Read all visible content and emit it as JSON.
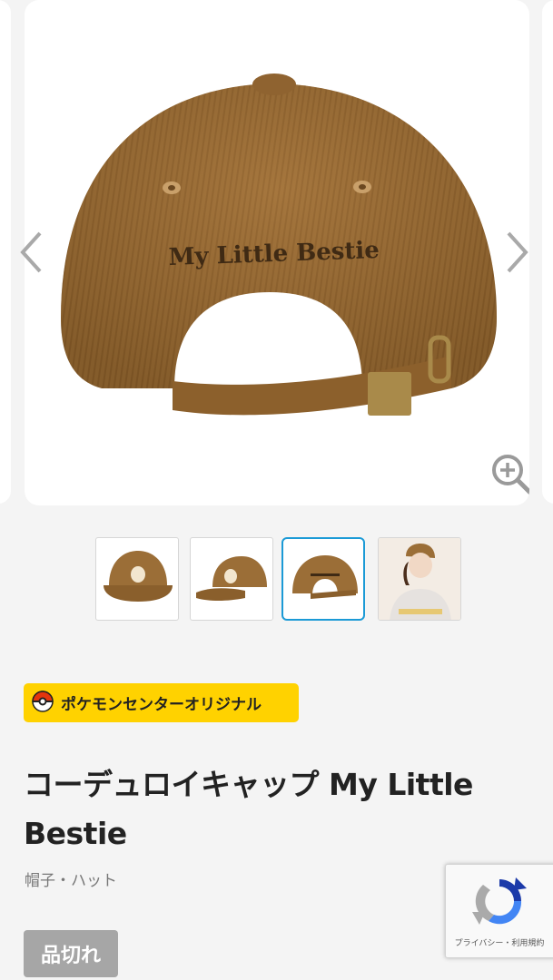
{
  "carousel": {
    "main_image": {
      "embroidery_text": "My Little Bestie",
      "alt": "corduroy cap back view"
    },
    "prev_icon": "chevron-left-icon",
    "next_icon": "chevron-right-icon",
    "zoom_icon": "zoom-in-icon"
  },
  "thumbnails": [
    {
      "view": "front",
      "active": false
    },
    {
      "view": "side",
      "active": false
    },
    {
      "view": "back",
      "active": true
    },
    {
      "view": "model",
      "active": false
    }
  ],
  "product": {
    "badge": {
      "icon": "pokeball-icon",
      "label": "ポケモンセンターオリジナル"
    },
    "title": "コーデュロイキャップ My Little Bestie",
    "category": "帽子・ハット",
    "status": "品切れ"
  },
  "recaptcha": {
    "text": "プライバシー・利用規約"
  },
  "colors": {
    "cap_brown": "#9b6e37",
    "badge_yellow": "#ffd200",
    "active_border": "#1b9ad6",
    "soldout_gray": "#a6a6a6"
  }
}
